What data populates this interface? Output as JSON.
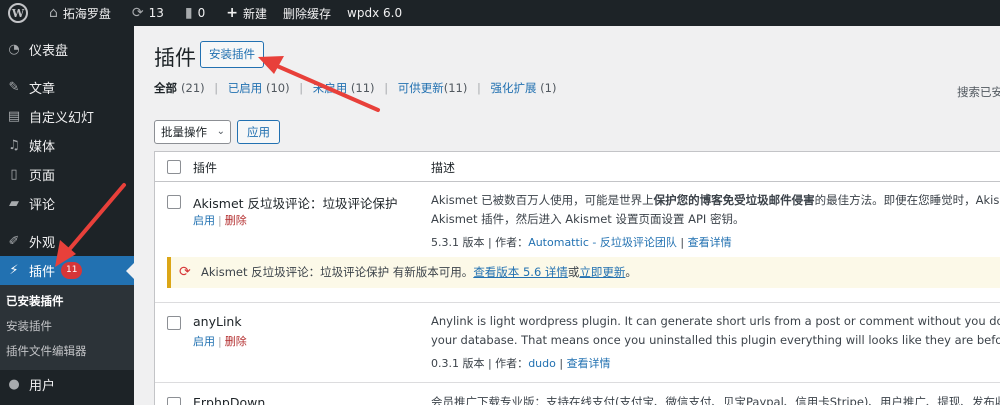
{
  "adminbar": {
    "site_name": "拓海罗盘",
    "updates_count": "13",
    "comments_count": "0",
    "new_label": "新建",
    "clear_cache_label": "删除缓存",
    "wpdx_label": "wpdx 6.0"
  },
  "sidebar": {
    "items": [
      {
        "label": "仪表盘",
        "icon": "dashboard-icon"
      },
      {
        "label": "文章",
        "icon": "pin-icon"
      },
      {
        "label": "自定义幻灯",
        "icon": "slides-icon"
      },
      {
        "label": "媒体",
        "icon": "media-icon"
      },
      {
        "label": "页面",
        "icon": "page-icon"
      },
      {
        "label": "评论",
        "icon": "comment-icon"
      },
      {
        "label": "外观",
        "icon": "appearance-icon"
      },
      {
        "label": "插件",
        "icon": "plugin-icon",
        "badge": "11"
      },
      {
        "label": "用户",
        "icon": "user-icon"
      }
    ],
    "submenu": [
      "已安装插件",
      "安装插件",
      "插件文件编辑器"
    ]
  },
  "page": {
    "title": "插件",
    "add_new": "安装插件",
    "search_hint": "搜索已安",
    "filters": [
      {
        "label": "全部",
        "count": "(21)"
      },
      {
        "label": "已启用",
        "count": "(10)"
      },
      {
        "label": "未启用",
        "count": "(11)"
      },
      {
        "label": "可供更新",
        "count": "(11)"
      },
      {
        "label": "强化扩展",
        "count": "(1)"
      }
    ],
    "bulk_action": "批量操作",
    "apply": "应用"
  },
  "table": {
    "col_plugin": "插件",
    "col_desc": "描述",
    "rows": [
      {
        "name": "Akismet 反垃圾评论：垃圾评论保护",
        "activate": "启用",
        "delete": "删除",
        "desc_line1_a": "Akismet 已被数百万人使用，可能是世界上",
        "desc_line1_b": "保护您的博客免受垃圾邮件侵害",
        "desc_line1_c": "的最佳方法。即便在您睡觉时，Akismet",
        "desc_line2": "Akismet 插件，然后进入 Akismet 设置页面设置 API 密钥。",
        "version": "5.3.1 版本 | 作者：",
        "author": "Automattic - 反垃圾评论团队",
        "view_details": "查看详情"
      },
      {
        "name": "anyLink",
        "activate": "启用",
        "delete": "删除",
        "desc_line1": "Anylink is light wordpress plugin. It can generate short urls from a post or comment without you do anythi",
        "desc_line2": "your database. That means once you uninstalled this plugin everything will looks like they are before.",
        "version": "0.3.1 版本 | 作者：",
        "author": "dudo",
        "view_details": "查看详情"
      },
      {
        "name": "ErphpDown",
        "desc_line1": "会员推广下载专业版：支持在线支付(支付宝、微信支付、贝宝Paypal、信用卡Stripe)、用户推广、提现、发布收费下"
      }
    ],
    "update_notice": {
      "text_a": "Akismet 反垃圾评论：垃圾评论保护 有新版本可用。",
      "view_link": "查看版本 5.6 详情",
      "or": "或",
      "update_link": "立即更新",
      "end": "。"
    }
  },
  "colors": {
    "accent": "#2271b1",
    "admin_dark": "#1d2327",
    "badge_red": "#d63638",
    "notice_yellow": "#dba617",
    "arrow": "#e8403a"
  }
}
